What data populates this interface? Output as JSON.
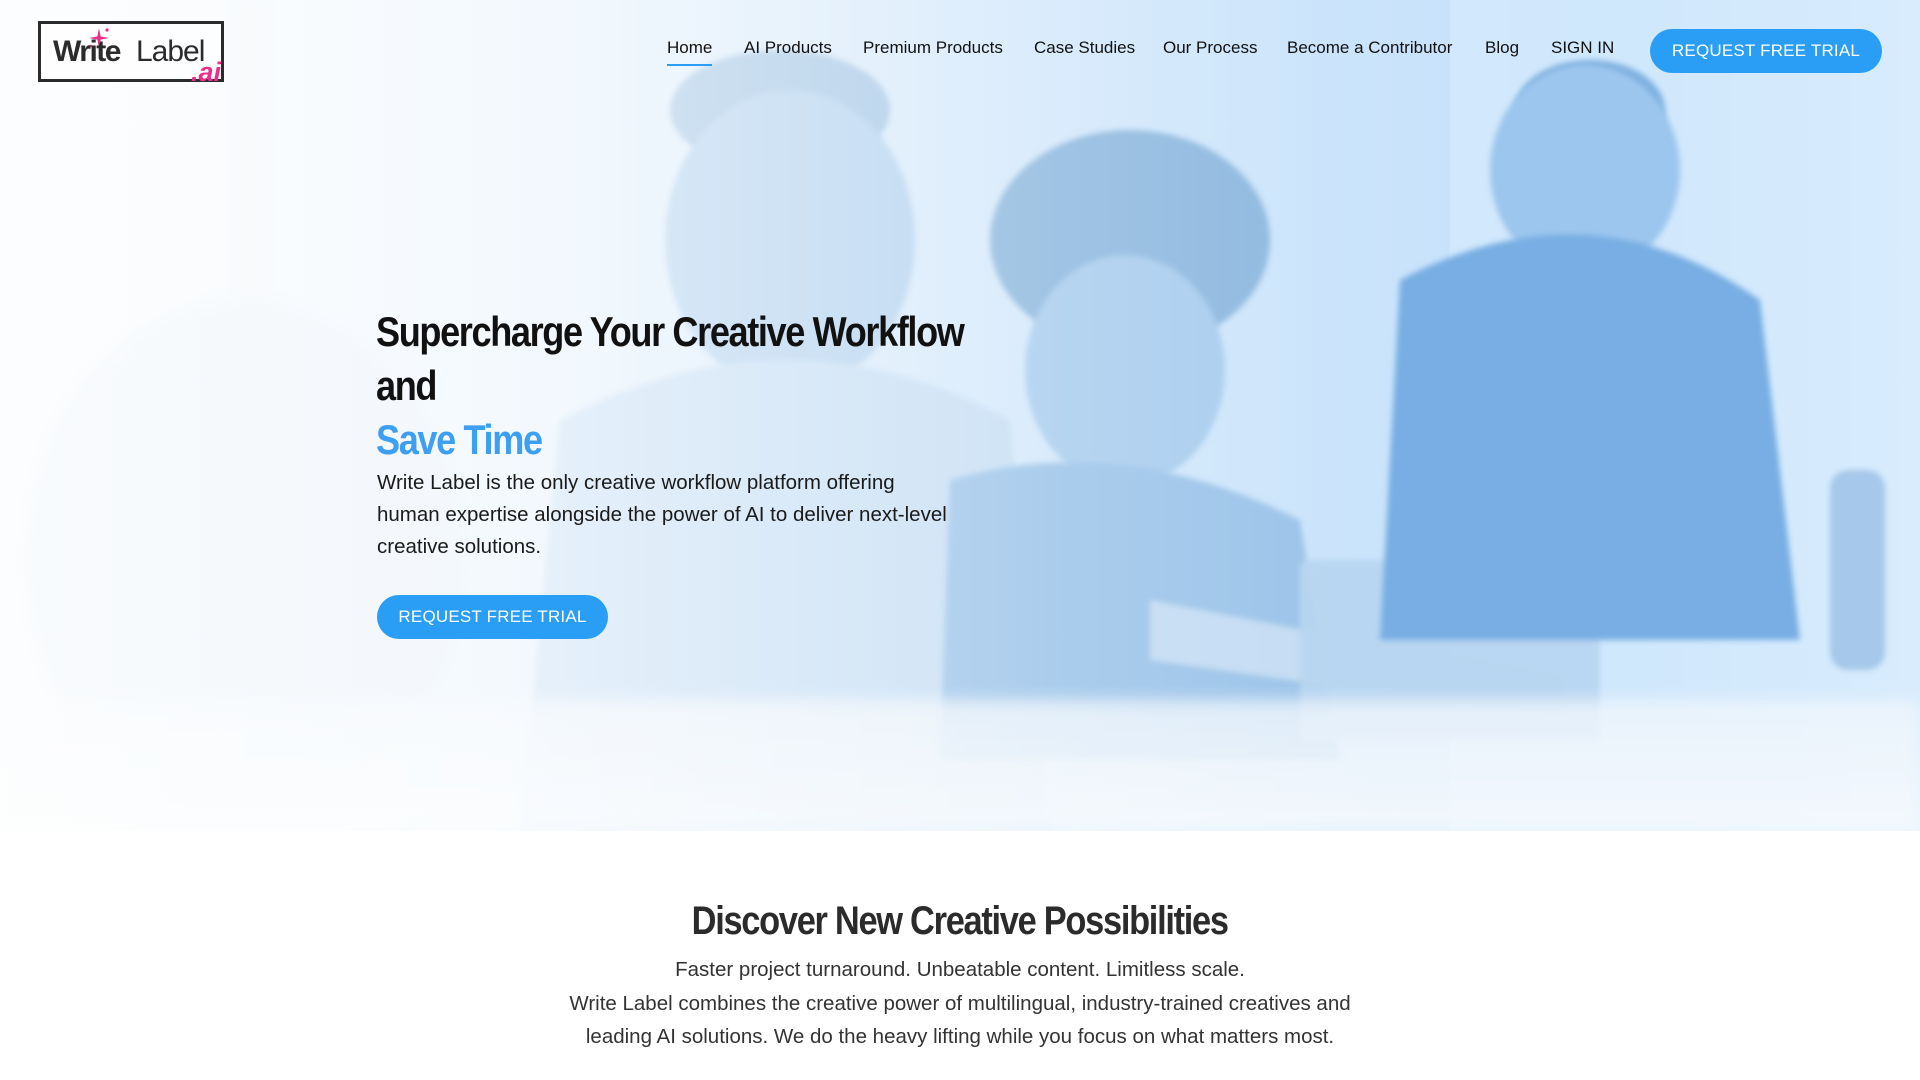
{
  "brand": {
    "logo_write": "Write",
    "logo_label": "Label",
    "logo_ai": ".ai",
    "accent_color": "#2a9df4",
    "logo_ai_color": "#e8308a"
  },
  "nav": {
    "items": [
      {
        "label": "Home",
        "active": true
      },
      {
        "label": "AI Products"
      },
      {
        "label": "Premium Products"
      },
      {
        "label": "Case Studies"
      },
      {
        "label": "Our Process"
      },
      {
        "label": "Become a Contributor"
      },
      {
        "label": "Blog"
      },
      {
        "label": "SIGN IN"
      }
    ],
    "cta_label": "REQUEST FREE TRIAL"
  },
  "hero": {
    "title_line1": "Supercharge Your Creative Workflow and",
    "title_line2": "Save Time",
    "description": "Write Label is the only creative workflow platform offering human expertise alongside the power of AI to deliver next-level creative solutions.",
    "cta_label": "REQUEST FREE TRIAL"
  },
  "discover": {
    "title": "Discover New Creative Possibilities",
    "tagline": "Faster project turnaround. Unbeatable content. Limitless scale.",
    "body": "Write Label combines the creative power of multilingual, industry-trained creatives and leading AI solutions. We do the heavy lifting while you focus on what matters most."
  }
}
